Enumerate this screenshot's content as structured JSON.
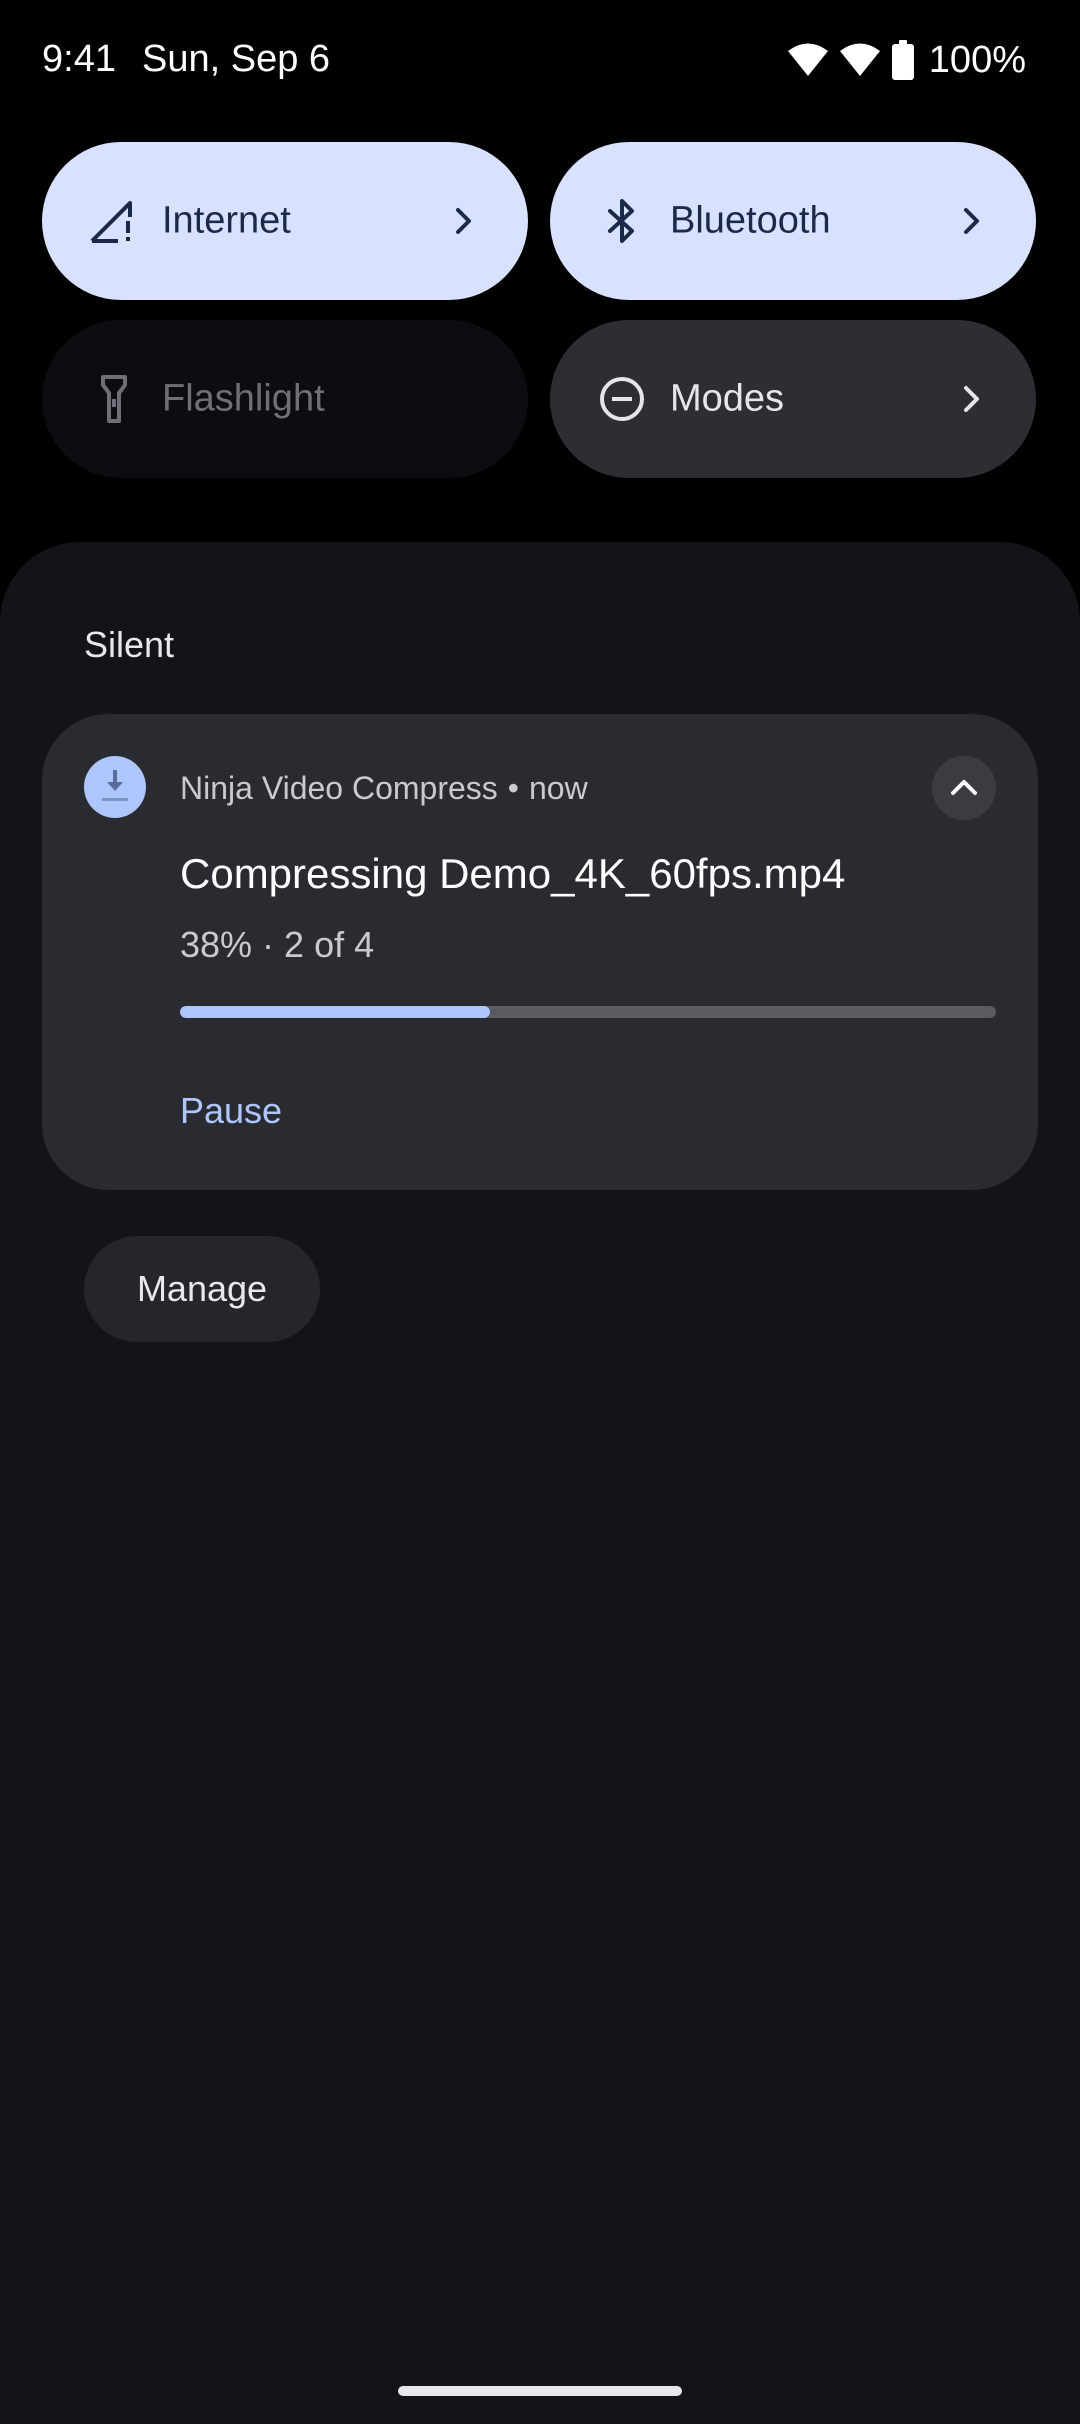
{
  "status_bar": {
    "time": "9:41",
    "date": "Sun, Sep 6",
    "battery": "100%",
    "icons": [
      "wifi-icon",
      "wifi-icon",
      "battery-icon"
    ]
  },
  "quick_settings": {
    "tiles": [
      {
        "label": "Internet",
        "icon": "signal-off-icon",
        "state": "active",
        "has_chevron": true
      },
      {
        "label": "Bluetooth",
        "icon": "bluetooth-icon",
        "state": "active",
        "has_chevron": true
      },
      {
        "label": "Flashlight",
        "icon": "flashlight-icon",
        "state": "off",
        "has_chevron": false
      },
      {
        "label": "Modes",
        "icon": "do-not-disturb-icon",
        "state": "neutral",
        "has_chevron": true
      }
    ]
  },
  "notifications": {
    "section_label": "Silent",
    "card": {
      "app_name": "Ninja Video Compress",
      "separator": "•",
      "time": "now",
      "app_icon": "download-icon",
      "title": "Compressing Demo_4K_60fps.mp4",
      "subtitle": "38% · 2 of 4",
      "progress": 0.38,
      "action_label": "Pause"
    },
    "manage_label": "Manage"
  },
  "colors": {
    "accent": "#adc6ff",
    "tile_active": "#d8e2ff",
    "shade_bg": "#131418",
    "card_bg": "#2a2b30"
  }
}
